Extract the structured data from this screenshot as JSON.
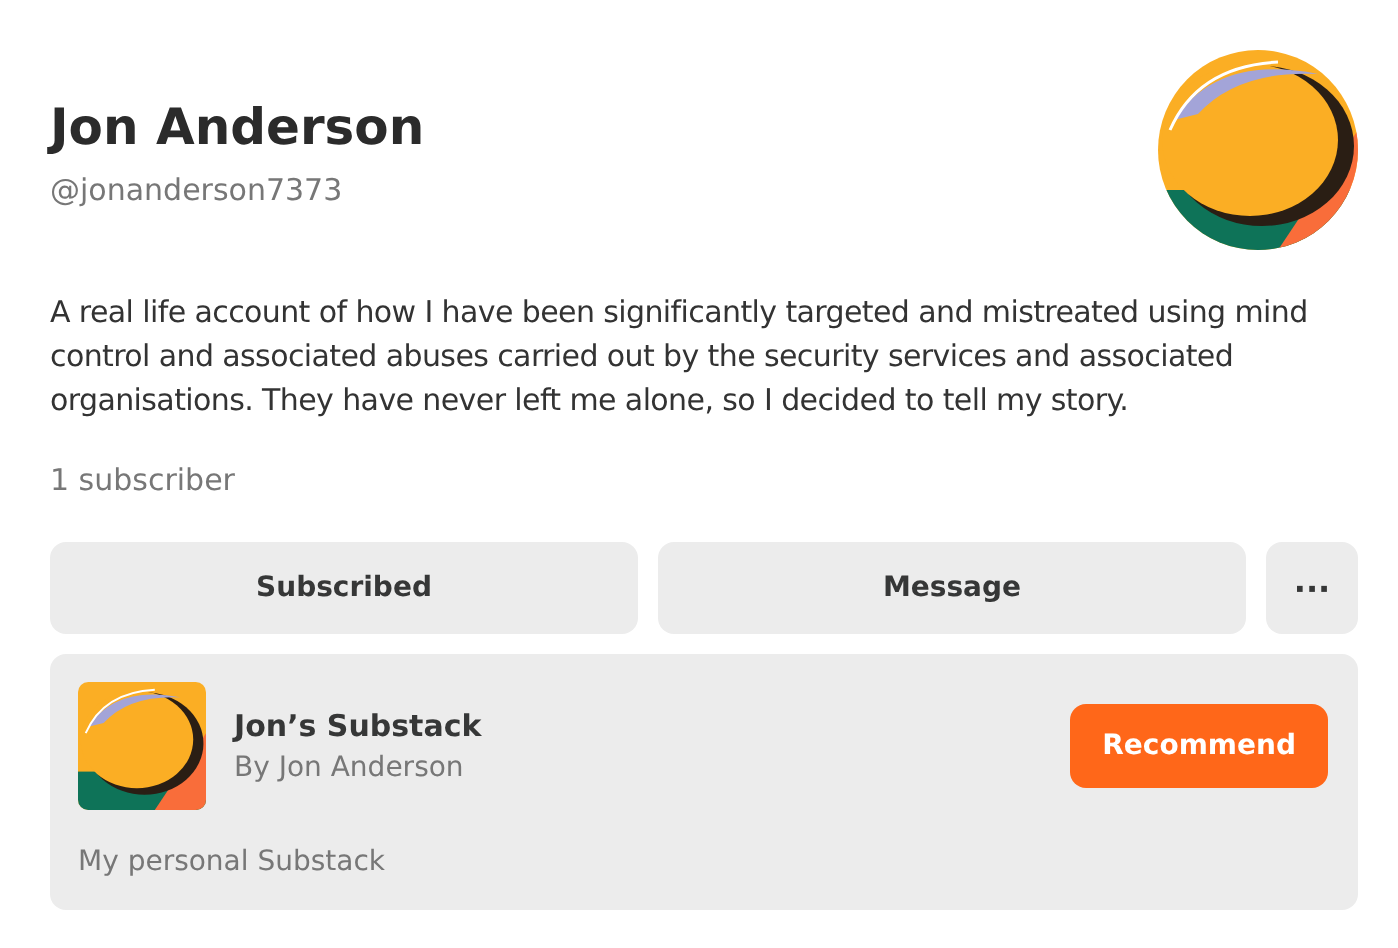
{
  "profile": {
    "name": "Jon Anderson",
    "handle": "@jonanderson7373",
    "bio": "A real life account of how I have been significantly targeted and mistreated using mind control and associated abuses carried out by the security services and associated organisations. They have never left me alone, so I decided to tell my story.",
    "subscribers": "1 subscriber"
  },
  "actions": [
    {
      "kind": "wide",
      "label": "Subscribed"
    },
    {
      "kind": "wide",
      "label": "Message"
    },
    {
      "kind": "more",
      "label": "···"
    }
  ],
  "publication": {
    "name": "Jon’s Substack",
    "author": "By Jon Anderson",
    "description": "My personal Substack",
    "button": "Recommend"
  }
}
